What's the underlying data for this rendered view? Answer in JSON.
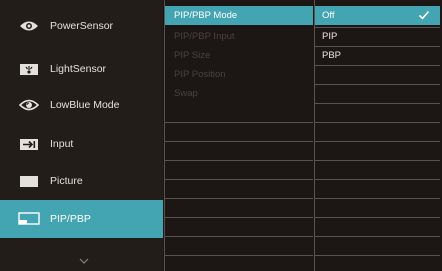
{
  "sidebar": {
    "items": [
      {
        "label": "PowerSensor",
        "icon": "eye-icon"
      },
      {
        "label": "LightSensor",
        "icon": "light-sensor-icon"
      },
      {
        "label": "LowBlue Mode",
        "icon": "lowblue-eye-icon"
      },
      {
        "label": "Input",
        "icon": "input-arrow-icon"
      },
      {
        "label": "Picture",
        "icon": "picture-icon"
      },
      {
        "label": "PIP/PBP",
        "icon": "pip-monitor-icon"
      }
    ],
    "active_index": 5,
    "more_icon": "chevron-down-icon"
  },
  "submenu": {
    "items": [
      "PIP/PBP Mode",
      "PIP/PBP Input",
      "PIP Size",
      "PIP Position",
      "Swap"
    ],
    "selected_index": 0
  },
  "options": {
    "items": [
      "Off",
      "PIP",
      "PBP"
    ],
    "selected_index": 0,
    "check_icon": "checkmark-icon"
  },
  "colors": {
    "accent": "#43a4b2",
    "background": "#1c1714",
    "disabled_text": "#4a423d"
  }
}
